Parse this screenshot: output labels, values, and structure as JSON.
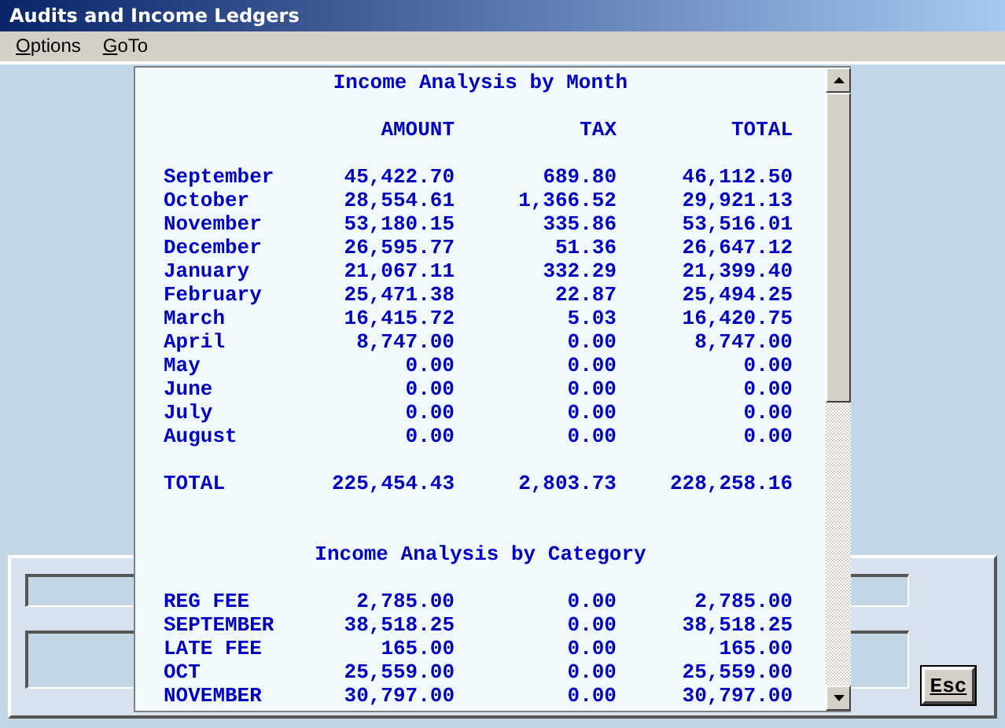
{
  "window": {
    "title": "Audits and Income Ledgers"
  },
  "menu": [
    {
      "label": "Options"
    },
    {
      "label": "GoTo"
    }
  ],
  "report": {
    "sections": [
      {
        "title": "Income Analysis by Month",
        "columns": [
          "AMOUNT",
          "TAX",
          "TOTAL"
        ],
        "rows": [
          {
            "label": "September",
            "amount": "45,422.70",
            "tax": "689.80",
            "total": "46,112.50"
          },
          {
            "label": "October",
            "amount": "28,554.61",
            "tax": "1,366.52",
            "total": "29,921.13"
          },
          {
            "label": "November",
            "amount": "53,180.15",
            "tax": "335.86",
            "total": "53,516.01"
          },
          {
            "label": "December",
            "amount": "26,595.77",
            "tax": "51.36",
            "total": "26,647.12"
          },
          {
            "label": "January",
            "amount": "21,067.11",
            "tax": "332.29",
            "total": "21,399.40"
          },
          {
            "label": "February",
            "amount": "25,471.38",
            "tax": "22.87",
            "total": "25,494.25"
          },
          {
            "label": "March",
            "amount": "16,415.72",
            "tax": "5.03",
            "total": "16,420.75"
          },
          {
            "label": "April",
            "amount": "8,747.00",
            "tax": "0.00",
            "total": "8,747.00"
          },
          {
            "label": "May",
            "amount": "0.00",
            "tax": "0.00",
            "total": "0.00"
          },
          {
            "label": "June",
            "amount": "0.00",
            "tax": "0.00",
            "total": "0.00"
          },
          {
            "label": "July",
            "amount": "0.00",
            "tax": "0.00",
            "total": "0.00"
          },
          {
            "label": "August",
            "amount": "0.00",
            "tax": "0.00",
            "total": "0.00"
          }
        ],
        "total": {
          "label": "TOTAL",
          "amount": "225,454.43",
          "tax": "2,803.73",
          "total": "228,258.16"
        }
      },
      {
        "title": "Income Analysis by Category",
        "rows": [
          {
            "label": "REG FEE",
            "amount": "2,785.00",
            "tax": "0.00",
            "total": "2,785.00"
          },
          {
            "label": "SEPTEMBER",
            "amount": "38,518.25",
            "tax": "0.00",
            "total": "38,518.25"
          },
          {
            "label": "LATE FEE",
            "amount": "165.00",
            "tax": "0.00",
            "total": "165.00"
          },
          {
            "label": "OCT",
            "amount": "25,559.00",
            "tax": "0.00",
            "total": "25,559.00"
          },
          {
            "label": "NOVEMBER",
            "amount": "30,797.00",
            "tax": "0.00",
            "total": "30,797.00"
          }
        ]
      }
    ]
  },
  "esc_button": {
    "label": "Esc"
  }
}
